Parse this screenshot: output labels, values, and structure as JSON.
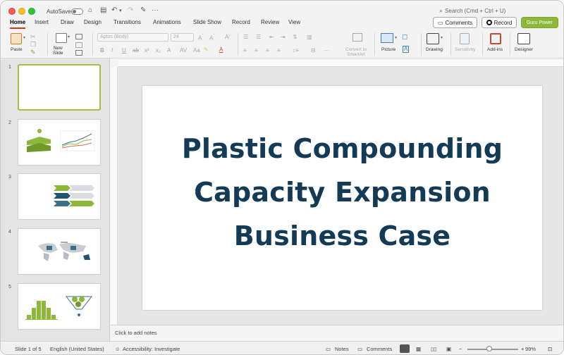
{
  "titlebar": {
    "autosave_label": "AutoSave",
    "search_placeholder": "Search (Cmd + Ctrl + U)"
  },
  "tabs": [
    {
      "label": "Home",
      "active": true
    },
    {
      "label": "Insert"
    },
    {
      "label": "Draw"
    },
    {
      "label": "Design"
    },
    {
      "label": "Transitions"
    },
    {
      "label": "Animations"
    },
    {
      "label": "Slide Show"
    },
    {
      "label": "Record"
    },
    {
      "label": "Review"
    },
    {
      "label": "View"
    }
  ],
  "top_buttons": {
    "comments": "Comments",
    "record": "Record",
    "guru": "Guru Power"
  },
  "ribbon": {
    "paste": "Paste",
    "new_slide": "New\nSlide",
    "font_name": "Aptos (Body)",
    "font_size": "24",
    "convert": "Convert to\nSmartArt",
    "picture": "Picture",
    "drawing": "Drawing",
    "sensitivity": "Sensitivity",
    "addins": "Add-ins",
    "designer": "Designer"
  },
  "slides": [
    {
      "num": "1",
      "selected": true
    },
    {
      "num": "2"
    },
    {
      "num": "3"
    },
    {
      "num": "4"
    },
    {
      "num": "5"
    }
  ],
  "slide": {
    "title_lines": [
      "Plastic Compounding",
      "Capacity Expansion",
      "Business Case"
    ],
    "title_color": "#133b55"
  },
  "notes_placeholder": "Click to add notes",
  "status": {
    "slide_count": "Slide 1 of 5",
    "language": "English (United States)",
    "accessibility": "Accessibility: Investigate",
    "notes": "Notes",
    "comments": "Comments",
    "zoom": "99%"
  },
  "colors": {
    "accent_green": "#8db83a",
    "tab_underline": "#c43e1c",
    "thumb_selected": "#a9bc3c"
  }
}
